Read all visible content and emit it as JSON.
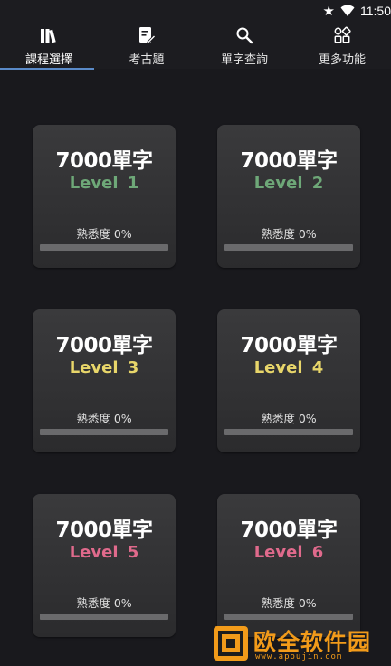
{
  "status": {
    "time": "11:50",
    "icons": [
      "star-icon",
      "wifi-icon"
    ]
  },
  "tabs": [
    {
      "label": "課程選擇",
      "icon": "books-icon",
      "active": true
    },
    {
      "label": "考古題",
      "icon": "edit-note-icon",
      "active": false
    },
    {
      "label": "單字查詢",
      "icon": "search-icon",
      "active": false
    },
    {
      "label": "更多功能",
      "icon": "grid-icon",
      "active": false
    }
  ],
  "colors": {
    "accent": "#5a8ac8",
    "level_green": "#6ea878",
    "level_yellow": "#e8d66a",
    "level_pink": "#e06a8c"
  },
  "cards": [
    {
      "title": "7000單字",
      "level": "Level  1",
      "level_color": "#6ea878",
      "progress_label": "熟悉度 0%",
      "progress": 0
    },
    {
      "title": "7000單字",
      "level": "Level  2",
      "level_color": "#6ea878",
      "progress_label": "熟悉度 0%",
      "progress": 0
    },
    {
      "title": "7000單字",
      "level": "Level  3",
      "level_color": "#e8d66a",
      "progress_label": "熟悉度 0%",
      "progress": 0
    },
    {
      "title": "7000單字",
      "level": "Level  4",
      "level_color": "#e8d66a",
      "progress_label": "熟悉度 0%",
      "progress": 0
    },
    {
      "title": "7000單字",
      "level": "Level  5",
      "level_color": "#e06a8c",
      "progress_label": "熟悉度 0%",
      "progress": 0
    },
    {
      "title": "7000單字",
      "level": "Level  6",
      "level_color": "#e06a8c",
      "progress_label": "熟悉度 0%",
      "progress": 0
    }
  ],
  "watermark": {
    "text": "欧全软件园",
    "url": "www.apoujin.com"
  }
}
